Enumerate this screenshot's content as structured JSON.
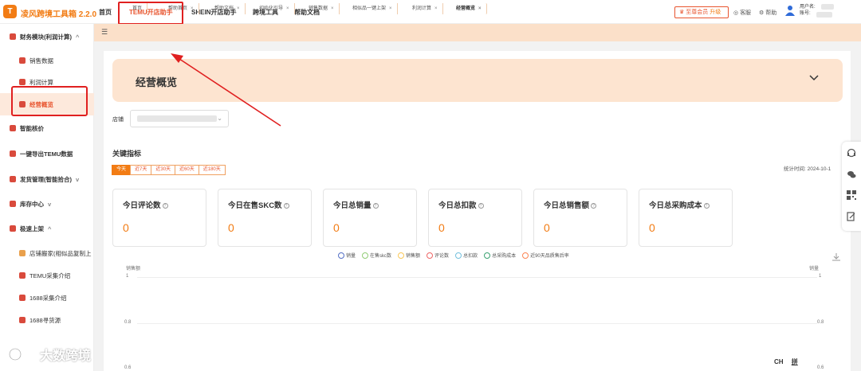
{
  "app": {
    "logo": "T",
    "title": "凌风跨境工具箱 2.2.0"
  },
  "nav": [
    {
      "label": "首页"
    },
    {
      "label": "TEMU开店助手"
    },
    {
      "label": "SHEIN开店助手"
    },
    {
      "label": "跨境工具"
    },
    {
      "label": "帮助文档"
    }
  ],
  "topright": {
    "vip": "至尊会员",
    "upgrade": "升级",
    "service": "客服",
    "help": "帮助",
    "username_label": "用户名:",
    "account_label": "账号:"
  },
  "sidebar": [
    {
      "label": "财务模块(利润计算)"
    },
    {
      "label": "销售数据"
    },
    {
      "label": "利润计算"
    },
    {
      "label": "经营概览"
    },
    {
      "label": "智能核价"
    },
    {
      "label": "一键导出TEMU数据"
    },
    {
      "label": "发货管理(智能拾合)"
    },
    {
      "label": "库存中心"
    },
    {
      "label": "极速上架"
    },
    {
      "label": "店铺搬家(相似品复制上"
    },
    {
      "label": "TEMU采集介绍"
    },
    {
      "label": "1688采集介绍"
    },
    {
      "label": "1688寻货源"
    }
  ],
  "tabs": [
    {
      "label": "首页"
    },
    {
      "label": "帮助首页"
    },
    {
      "label": "帮助文档"
    },
    {
      "label": "初始化引导"
    },
    {
      "label": "销售数据"
    },
    {
      "label": "相似品一键上架"
    },
    {
      "label": "利润计算"
    },
    {
      "label": "经营概览"
    }
  ],
  "banner": {
    "title": "经营概览"
  },
  "store": {
    "label": "店铺"
  },
  "key": {
    "title": "关键指标",
    "ranges": [
      "今天",
      "近7天",
      "近30天",
      "近60天",
      "近180天"
    ],
    "selected": "今天",
    "stat_time": "统计时间: 2024-10-1"
  },
  "cards": [
    {
      "title": "今日评论数",
      "value": "0"
    },
    {
      "title": "今日在售SKC数",
      "value": "0"
    },
    {
      "title": "今日总销量",
      "value": "0"
    },
    {
      "title": "今日总扣款",
      "value": "0"
    },
    {
      "title": "今日总销售额",
      "value": "0"
    },
    {
      "title": "今日总采购成本",
      "value": "0"
    }
  ],
  "chart_data": {
    "type": "line",
    "series": [
      {
        "name": "销量",
        "color": "#5470c6",
        "values": []
      },
      {
        "name": "在售skc数",
        "color": "#91cc75",
        "values": []
      },
      {
        "name": "销售额",
        "color": "#fac858",
        "values": []
      },
      {
        "name": "评论数",
        "color": "#ee6666",
        "values": []
      },
      {
        "name": "总扣款",
        "color": "#73c0de",
        "values": []
      },
      {
        "name": "总采购成本",
        "color": "#3ba272",
        "values": []
      },
      {
        "name": "近90天品质售后率",
        "color": "#fc8452",
        "values": []
      }
    ],
    "ylabel": "销售额",
    "ylabel_right": "销量",
    "yticks": [
      "1",
      "0.8",
      "0.6"
    ],
    "grid": true,
    "legend": "top-center"
  },
  "ime": {
    "a": "CH",
    "b": "拼"
  },
  "watermark": "大数跨境"
}
